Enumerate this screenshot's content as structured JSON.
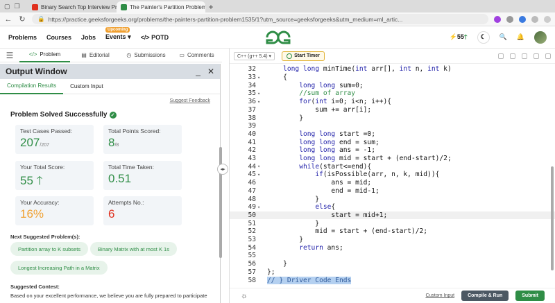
{
  "browser": {
    "tabs": [
      {
        "title": "Binary Search Top Interview Prob",
        "favicon_color": "#e0301e",
        "active": false
      },
      {
        "title": "The Painter's Partition Problem-II",
        "favicon_color": "#2f8d46",
        "active": true
      }
    ],
    "new_tab": "+",
    "url": "https://practice.geeksforgeeks.org/problems/the-painters-partition-problem1535/1?utm_source=geeksforgeeks&utm_medium=ml_artic..."
  },
  "site": {
    "menu": {
      "problems": "Problems",
      "courses": "Courses",
      "jobs": "Jobs",
      "events": "Events",
      "events_badge": "Upcoming",
      "potd": "POTD"
    },
    "streak": "55"
  },
  "left_tabs": {
    "problem": "Problem",
    "editorial": "Editorial",
    "submissions": "Submissions",
    "comments": "Comments"
  },
  "output": {
    "title": "Output Window",
    "tabs": {
      "compilation": "Compilation Results",
      "custom": "Custom Input"
    },
    "feedback": "Suggest Feedback",
    "status": "Problem Solved Successfully",
    "cards": {
      "tests_label": "Test Cases Passed:",
      "tests_value": "207",
      "tests_total": "/207",
      "points_label": "Total Points Scored:",
      "points_value": "8",
      "points_total": "/8",
      "score_label": "Your Total Score:",
      "score_value": "55",
      "time_label": "Total Time Taken:",
      "time_value": "0.51",
      "accuracy_label": "Your Accuracy:",
      "accuracy_value": "16%",
      "attempts_label": "Attempts No.:",
      "attempts_value": "6"
    },
    "suggested_heading": "Next Suggested Problem(s):",
    "suggested": [
      "Partition array to K subsets",
      "Binary Matrix with at most K 1s",
      "Longest Increasing Path in a Matrix"
    ],
    "contest_heading": "Suggested Contest:",
    "contest_text": "Based on your excellent performance, we believe you are fully prepared to participate"
  },
  "editor": {
    "language": "C++ (g++ 5.4)",
    "timer": "Start Timer",
    "lines": [
      {
        "n": "32",
        "fold": "",
        "t": "    long long minTime(int arr[], int n, int k)"
      },
      {
        "n": "33",
        "fold": "▾",
        "t": "    {"
      },
      {
        "n": "34",
        "fold": "",
        "t": "        long long sum=0;"
      },
      {
        "n": "35",
        "fold": "▾",
        "t": "        //sum of array"
      },
      {
        "n": "36",
        "fold": "▾",
        "t": "        for(int i=0; i<n; i++){"
      },
      {
        "n": "37",
        "fold": "",
        "t": "            sum += arr[i];"
      },
      {
        "n": "38",
        "fold": "",
        "t": "        }"
      },
      {
        "n": "39",
        "fold": "",
        "t": ""
      },
      {
        "n": "40",
        "fold": "",
        "t": "        long long start =0;"
      },
      {
        "n": "41",
        "fold": "",
        "t": "        long long end = sum;"
      },
      {
        "n": "42",
        "fold": "",
        "t": "        long long ans = -1;"
      },
      {
        "n": "43",
        "fold": "",
        "t": "        long long mid = start + (end-start)/2;"
      },
      {
        "n": "44",
        "fold": "▾",
        "t": "        while(start<=end){"
      },
      {
        "n": "45",
        "fold": "▾",
        "t": "            if(isPossible(arr, n, k, mid)){"
      },
      {
        "n": "46",
        "fold": "",
        "t": "                ans = mid;"
      },
      {
        "n": "47",
        "fold": "",
        "t": "                end = mid-1;"
      },
      {
        "n": "48",
        "fold": "",
        "t": "            }"
      },
      {
        "n": "49",
        "fold": "▾",
        "t": "            else{"
      },
      {
        "n": "50",
        "fold": "",
        "t": "                start = mid+1;"
      },
      {
        "n": "51",
        "fold": "",
        "t": "            }"
      },
      {
        "n": "52",
        "fold": "",
        "t": "            mid = start + (end-start)/2;"
      },
      {
        "n": "53",
        "fold": "",
        "t": "        }"
      },
      {
        "n": "54",
        "fold": "",
        "t": "        return ans;"
      },
      {
        "n": "55",
        "fold": "",
        "t": ""
      },
      {
        "n": "56",
        "fold": "",
        "t": "    }"
      },
      {
        "n": "57",
        "fold": "",
        "t": "};"
      },
      {
        "n": "58",
        "fold": "",
        "t": "// } Driver Code Ends"
      }
    ],
    "highlight_line": "50",
    "custom_input": "Custom Input",
    "compile": "Compile & Run",
    "submit": "Submit"
  }
}
